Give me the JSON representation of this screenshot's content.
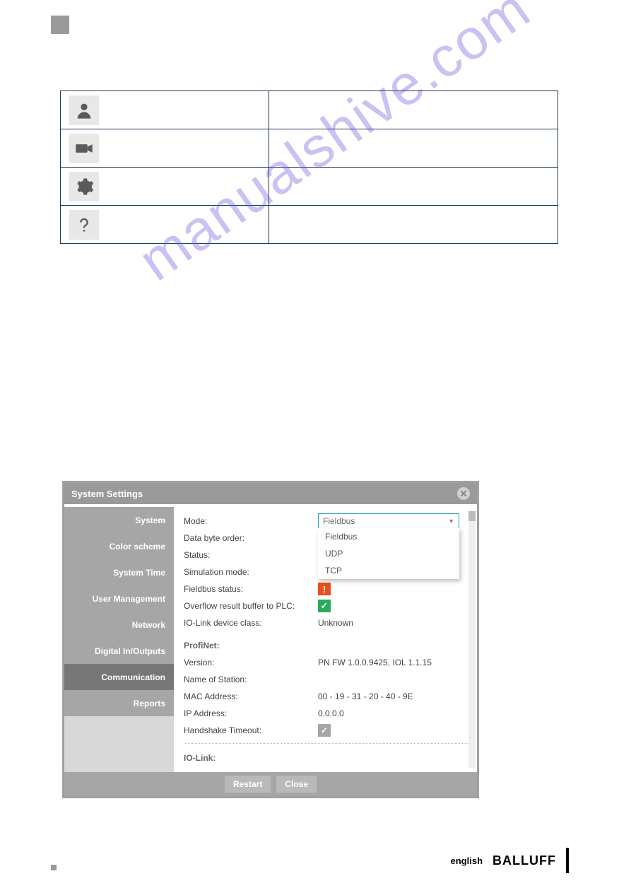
{
  "watermark": "manualshive.com",
  "icon_rows": [
    {
      "name": "user-icon"
    },
    {
      "name": "camera-icon"
    },
    {
      "name": "gear-icon"
    },
    {
      "name": "help-icon"
    }
  ],
  "dialog": {
    "title": "System Settings",
    "sidebar": [
      {
        "label": "System",
        "active": false
      },
      {
        "label": "Color scheme",
        "active": false
      },
      {
        "label": "System Time",
        "active": false
      },
      {
        "label": "User Management",
        "active": false
      },
      {
        "label": "Network",
        "active": false
      },
      {
        "label": "Digital In/Outputs",
        "active": false
      },
      {
        "label": "Communication",
        "active": true
      },
      {
        "label": "Reports",
        "active": false
      }
    ],
    "dropdown": {
      "selected": "Fieldbus",
      "options": [
        "Fieldbus",
        "UDP",
        "TCP"
      ]
    },
    "fields": {
      "mode_label": "Mode:",
      "data_byte_order_label": "Data byte order:",
      "status_label": "Status:",
      "simulation_mode_label": "Simulation mode:",
      "fieldbus_status_label": "Fieldbus status:",
      "overflow_label": "Overflow result buffer to PLC:",
      "iolink_class_label": "IO-Link device class:",
      "iolink_class_value": "Unknown",
      "profinet_section": "ProfiNet:",
      "version_label": "Version:",
      "version_value": "PN FW 1.0.0.9425, IOL 1.1.15",
      "name_station_label": "Name of Station:",
      "mac_label": "MAC Address:",
      "mac_value": "00 - 19 - 31 - 20 - 40 - 9E",
      "ip_label": "IP Address:",
      "ip_value": "0.0.0.0",
      "handshake_label": "Handshake Timeout:",
      "iolink_section": "IO-Link:"
    },
    "buttons": {
      "restart": "Restart",
      "close": "Close"
    }
  },
  "footer": {
    "language": "english",
    "brand": "BALLUFF"
  }
}
